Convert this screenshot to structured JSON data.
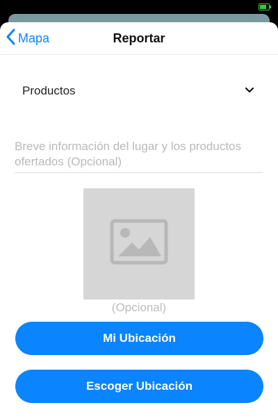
{
  "nav": {
    "back_label": "Mapa",
    "title": "Reportar"
  },
  "form": {
    "category": {
      "value": "Productos",
      "icon": "chevron-down-icon"
    },
    "description": {
      "value": "",
      "placeholder": "Breve información del lugar y los productos ofertados (Opcional)"
    },
    "photo": {
      "icon": "image-placeholder-icon",
      "caption": "(Opcional)"
    }
  },
  "actions": {
    "my_location_label": "Mi Ubicación",
    "choose_location_label": "Escoger Ubicación"
  },
  "colors": {
    "accent": "#0a84ff",
    "battery": "#2ecc40"
  }
}
